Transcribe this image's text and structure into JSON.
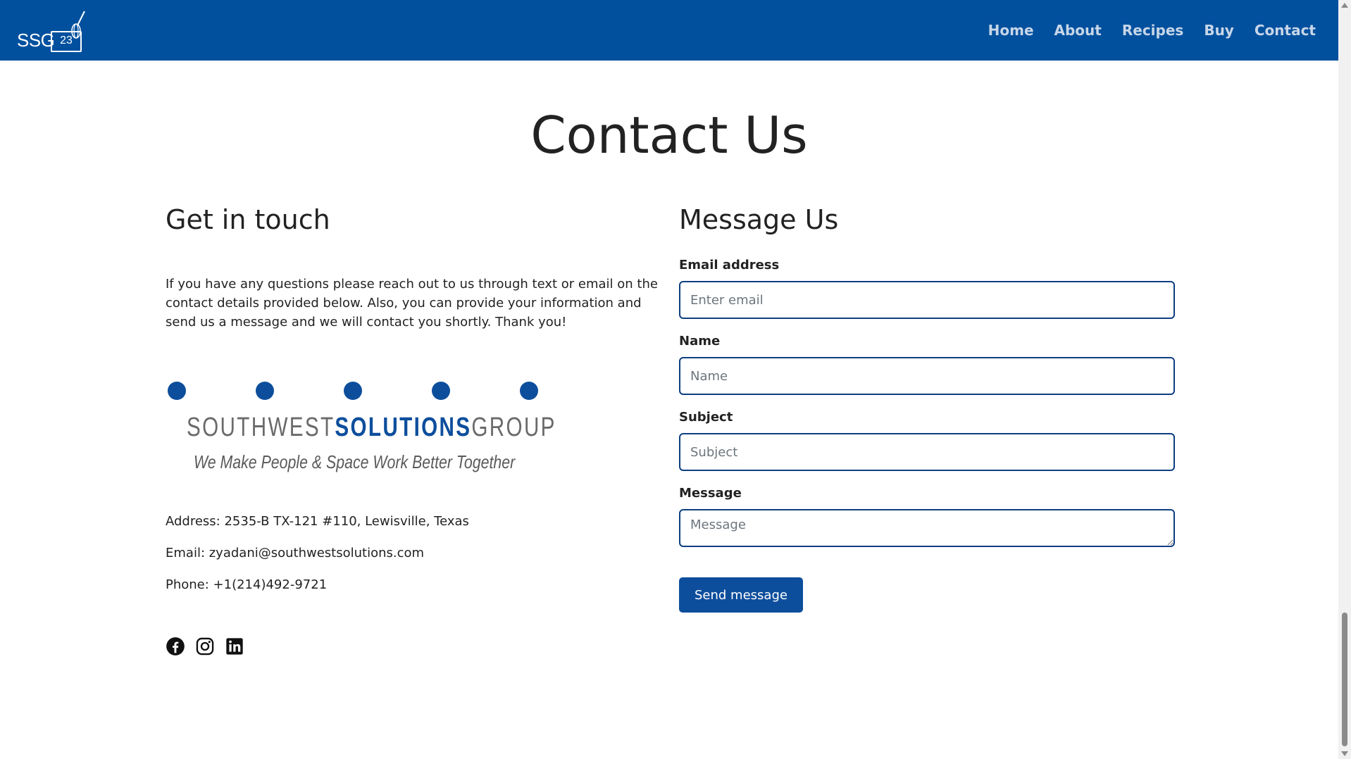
{
  "navbar": {
    "brand_text": "SSG",
    "brand_badge": "23",
    "links": [
      "Home",
      "About",
      "Recipes",
      "Buy",
      "Contact"
    ],
    "color": "#00509e"
  },
  "page_title": "Contact Us",
  "get_in_touch": {
    "title": "Get in touch",
    "intro": "If you have any questions please reach out to us through text or email on the contact details provided below. Also, you can provide your information and send us a message and we will contact you shortly. Thank you!",
    "logo": {
      "wordmark_light_1": "SOUTHWEST",
      "wordmark_bold": "SOLUTIONS",
      "wordmark_light_2": "GROUP",
      "tagline": "We Make People & Space Work Better Together"
    },
    "address": "Address: 2535-B TX-121 #110, Lewisville, Texas",
    "email": "Email: zyadani@southwestsolutions.com",
    "phone": "Phone: +1(214)492-9721",
    "socials": [
      "facebook-icon",
      "instagram-icon",
      "linkedin-icon"
    ]
  },
  "message_us": {
    "title": "Message Us",
    "email_label": "Email address",
    "email_placeholder": "Enter email",
    "name_label": "Name",
    "name_placeholder": "Name",
    "subject_label": "Subject",
    "subject_placeholder": "Subject",
    "message_label": "Message",
    "message_placeholder": "Message",
    "send_label": "Send message"
  },
  "accent_color": "#0d4e9c"
}
